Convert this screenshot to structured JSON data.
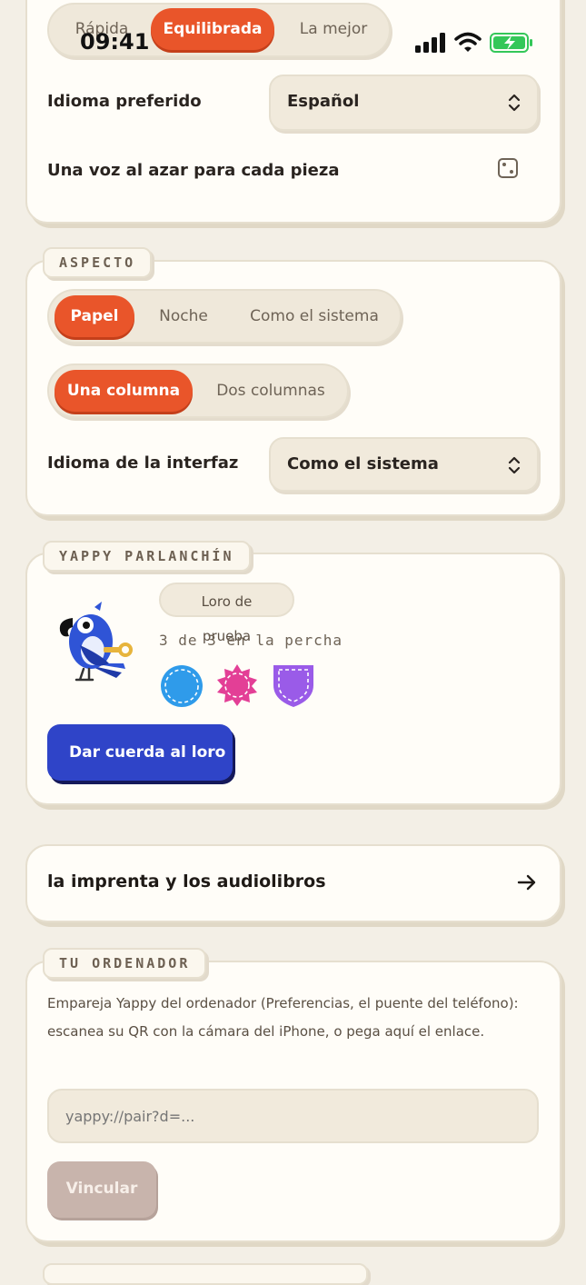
{
  "status_bar": {
    "time": "09:41"
  },
  "voice": {
    "quality_options": [
      "Rápida",
      "Equilibrada",
      "La mejor"
    ],
    "quality_selected": "Equilibrada",
    "preferred_language_label": "Idioma preferido",
    "preferred_language_value": "Español",
    "random_voice_label": "Una voz al azar para cada pieza"
  },
  "appearance": {
    "section_title": "ASPECTO",
    "theme_options": [
      "Papel",
      "Noche",
      "Como el sistema"
    ],
    "theme_selected": "Papel",
    "layout_options": [
      "Una columna",
      "Dos columnas"
    ],
    "layout_selected": "Una columna",
    "interface_language_label": "Idioma de la interfaz",
    "interface_language_value": "Como el sistema"
  },
  "parrot": {
    "section_title": "YAPPY PARLANCHÍN",
    "name_badge": "Loro de prueba",
    "perch_text": "3 de 3 en la percha",
    "badge_colors": [
      "#2f9bea",
      "#e33f96",
      "#9a5be8"
    ],
    "wind_button": "Dar cuerda al loro"
  },
  "link_row": {
    "label": "la imprenta y los audiolibros"
  },
  "computer": {
    "section_title": "TU ORDENADOR",
    "description": "Empareja Yappy del ordenador (Preferencias, el puente del teléfono): escanea su QR con la cámara del iPhone, o pega aquí el enlace.",
    "input_placeholder": "yappy://pair?d=...",
    "link_button": "Vincular"
  },
  "colors": {
    "accent": "#e9552a",
    "primary_button": "#2f44c8",
    "background": "#f3efe6"
  }
}
